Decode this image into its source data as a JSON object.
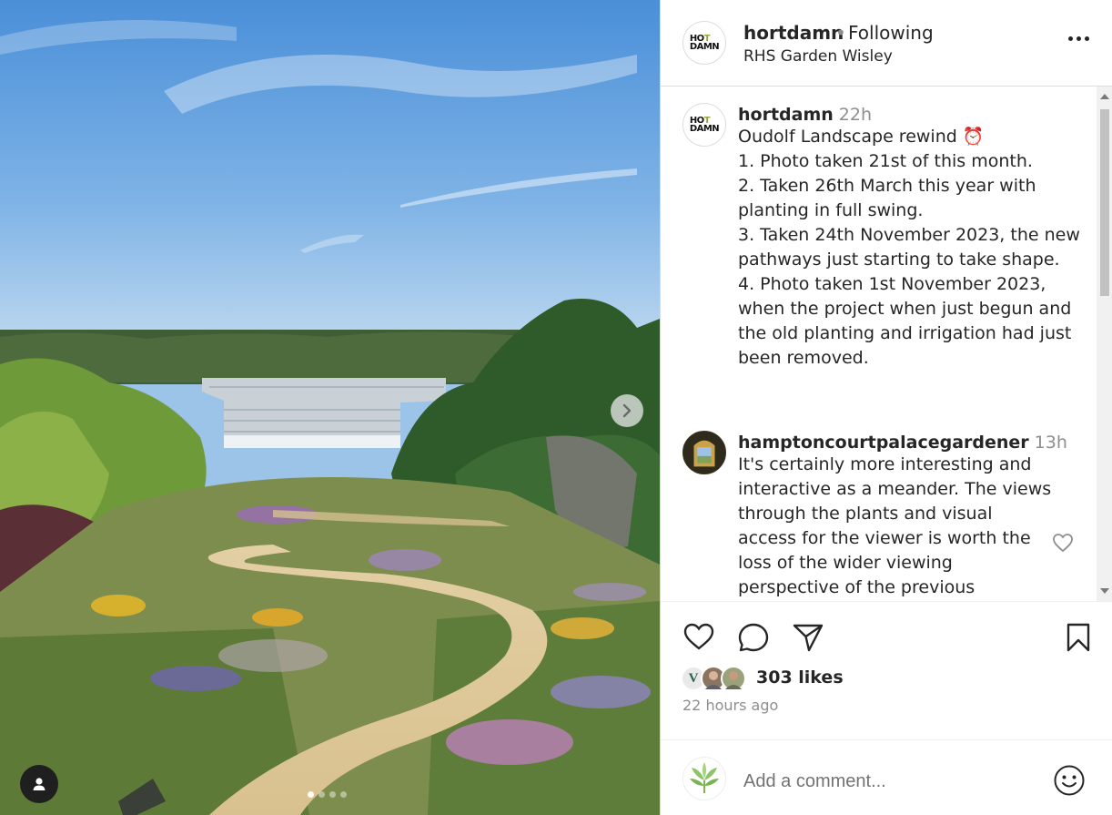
{
  "post": {
    "username": "hortdamn",
    "separator": "•",
    "follow_status": "Following",
    "location": "RHS Garden Wisley",
    "avatar_text": [
      "HO",
      "T",
      "DAMN"
    ],
    "image_slide_count": 4,
    "image_active_index": 0
  },
  "caption": {
    "username": "hortdamn",
    "time": "22h",
    "lines": [
      "Oudolf Landscape rewind ⏰",
      "",
      "1. Photo taken 21st of this month.",
      "2. Taken 26th March this year with",
      "planting in full swing.",
      "3. Taken 24th November 2023, the new",
      "pathways just starting to take shape.",
      "4. Photo taken 1st November 2023,",
      "when the project when just begun and",
      "the old planting and irrigation had just",
      "been removed."
    ]
  },
  "comment": {
    "username": "hamptoncourtpalacegardener",
    "time": "13h",
    "lines": [
      "It's certainly more interesting and",
      "interactive as a meander. The views",
      "through the plants and visual",
      "access for the viewer is worth the",
      "loss of the wider viewing",
      "perspective of the previous"
    ]
  },
  "engagement": {
    "likes": "303 likes",
    "time_ago": "22 hours ago"
  },
  "add_comment": {
    "placeholder": "Add a comment..."
  },
  "icons": {
    "like": "heart-icon",
    "comment": "speech-bubble-icon",
    "share": "paper-plane-icon",
    "save": "bookmark-icon",
    "more": "more-options-icon",
    "next": "chevron-right-icon",
    "tag": "user-tag-icon",
    "emoji": "smiley-icon"
  },
  "colors": {
    "text": "#262626",
    "muted": "#8e8e8e",
    "border": "#dbdbdb"
  }
}
